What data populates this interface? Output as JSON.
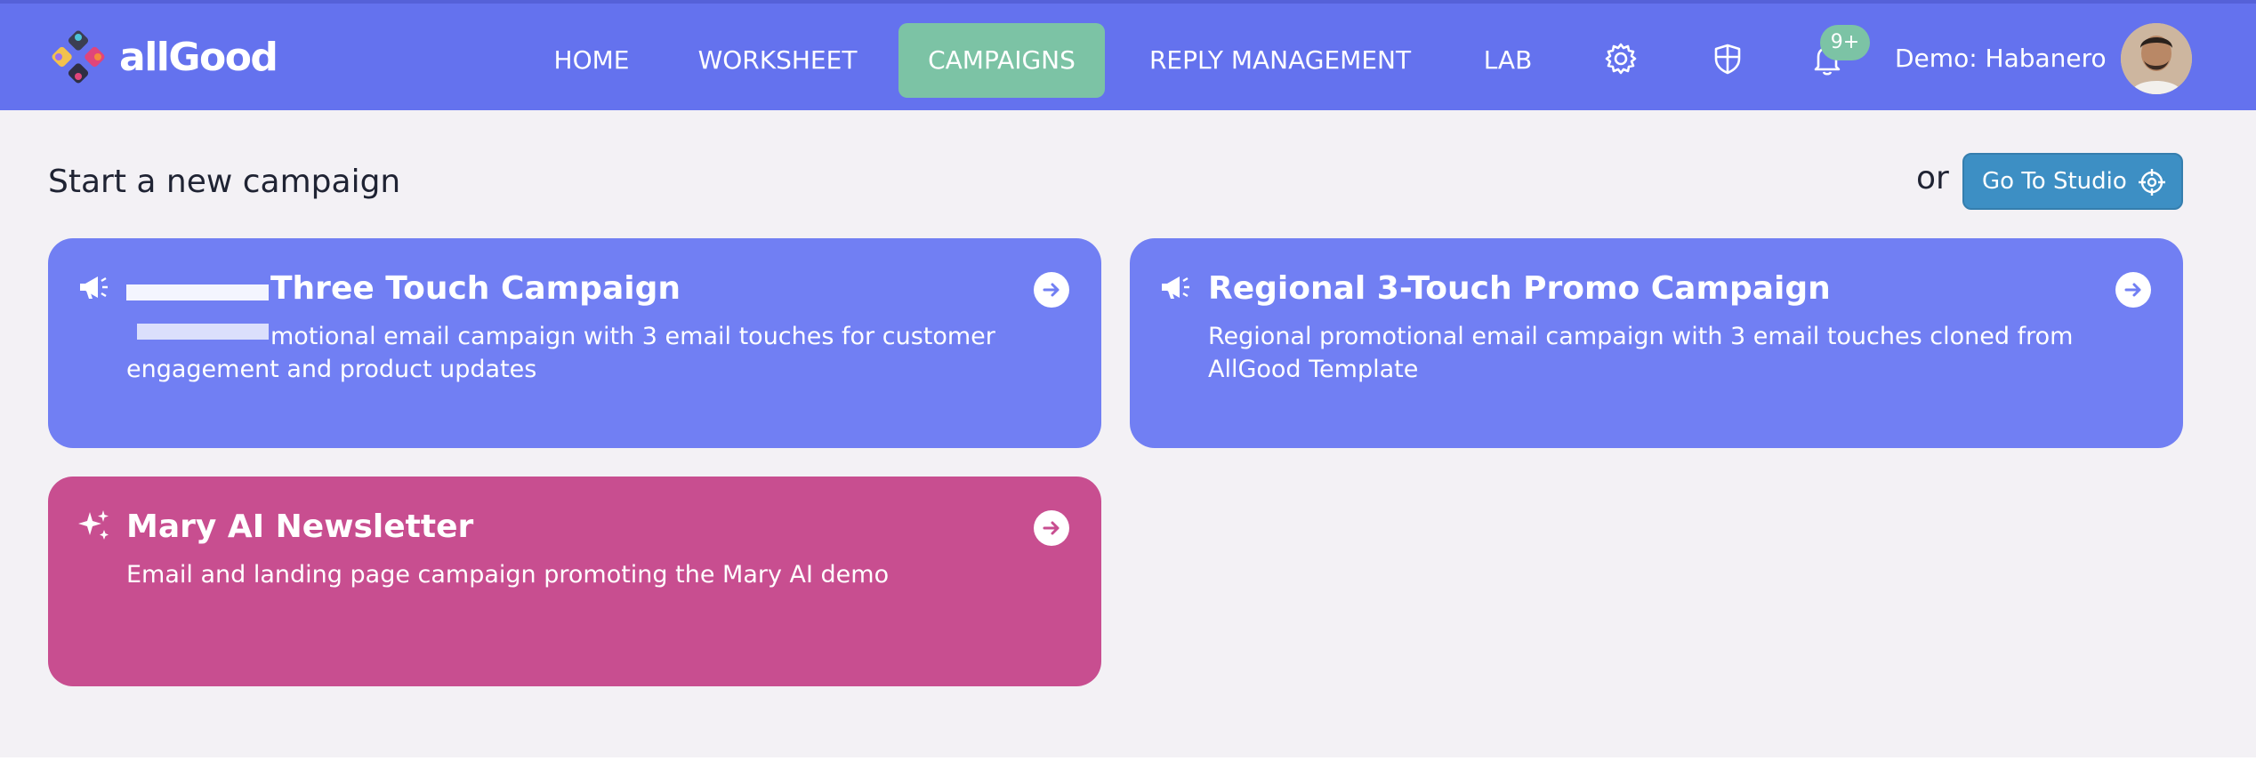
{
  "app": {
    "name": "allGood"
  },
  "nav": {
    "items": [
      {
        "label": "HOME"
      },
      {
        "label": "WORKSHEET"
      },
      {
        "label": "CAMPAIGNS",
        "active": true
      },
      {
        "label": "REPLY MANAGEMENT"
      },
      {
        "label": "LAB"
      }
    ],
    "notifications_badge": "9+",
    "user_label": "Demo: Habanero"
  },
  "main": {
    "title": "Start a new campaign",
    "or_label": "or",
    "studio_button": "Go To Studio"
  },
  "campaigns": [
    {
      "icon": "megaphone-icon",
      "title": "Three Touch Campaign",
      "description": "motional email campaign with 3 email touches for customer engagement and product updates",
      "color": "#717ff3"
    },
    {
      "icon": "megaphone-icon",
      "title": "Regional 3-Touch Promo Campaign",
      "description": "Regional promotional email campaign with 3 email touches cloned from AllGood Template",
      "color": "#717ff3"
    },
    {
      "icon": "sparkles-icon",
      "title": "Mary AI Newsletter",
      "description": "Email and landing page campaign promoting the Mary AI demo",
      "color": "#c84e90"
    }
  ],
  "colors": {
    "topbar": "#6472ee",
    "active_tab": "#7cc3a5",
    "studio_button": "#3d8fc4",
    "background": "#f3f1f5"
  }
}
